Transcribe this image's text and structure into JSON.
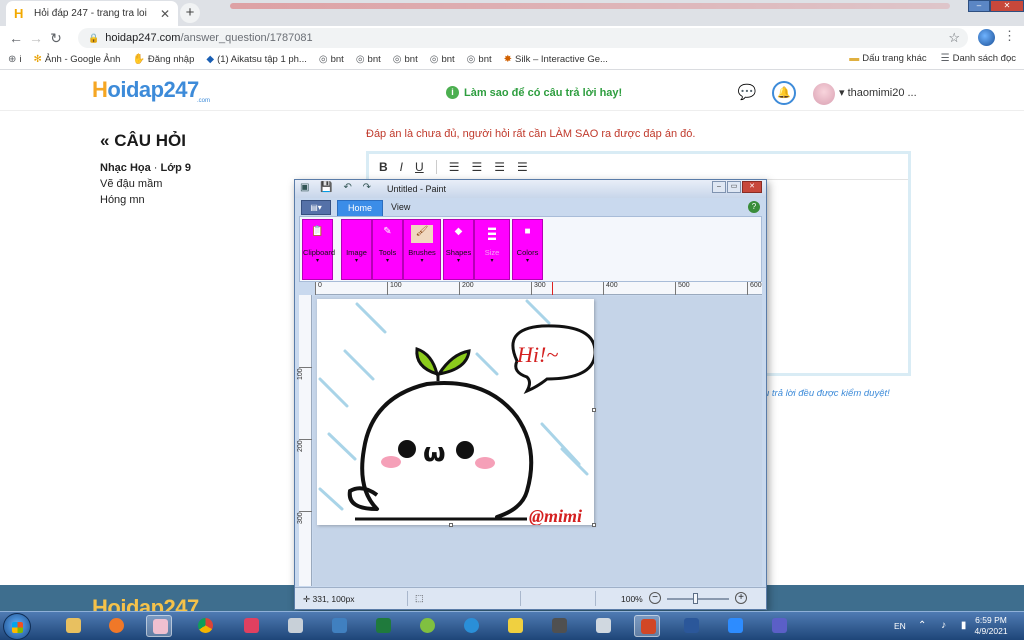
{
  "browser": {
    "tab_title": "Hỏi đáp 247 - trang tra loi",
    "tab_favicon": "H",
    "new_tab": "+",
    "url_host": "hoidap247.com",
    "url_path": "/answer_question/1787081",
    "bookmarks": [
      {
        "icon": "apps-icon",
        "label": "i"
      },
      {
        "icon": "google-photos-icon",
        "label": "Ảnh - Google Ảnh"
      },
      {
        "icon": "hand-icon",
        "label": "Đăng nhập"
      },
      {
        "icon": "azota-icon",
        "label": "(1) Aikatsu tập 1 ph..."
      },
      {
        "icon": "globe-icon",
        "label": "bnt"
      },
      {
        "icon": "globe-icon",
        "label": "bnt"
      },
      {
        "icon": "globe-icon",
        "label": "bnt"
      },
      {
        "icon": "globe-icon",
        "label": "bnt"
      },
      {
        "icon": "globe-icon",
        "label": "bnt"
      },
      {
        "icon": "silk-icon",
        "label": "Silk – Interactive Ge..."
      }
    ],
    "bookmarks_other": "Dấu trang khác",
    "reading_list": "Danh sách đọc"
  },
  "site": {
    "logo_h": "H",
    "logo_rest": "oidap247",
    "logo_sub": ".com",
    "tip": "Làm sao để có câu trả lời hay!",
    "username": "thaomimi20 ...",
    "question_heading": "CÂU HỎI",
    "subject": "Nhạc Họa",
    "grade": "Lớp 9",
    "question_line1": "Vẽ đậu mầm",
    "question_line2": "Hóng mn",
    "warning": "Đáp án là chưa đủ, người hỏi rất cần LÀM SAO ra được đáp án đó.",
    "editor_tools": [
      "B",
      "I",
      "U"
    ],
    "note_suffix": "u trả lời đều được kiểm duyệt!",
    "footer_logo": "Hoidap247"
  },
  "paint": {
    "title": "Untitled - Paint",
    "tabs": [
      "Home",
      "View"
    ],
    "groups": [
      "Clipboard",
      "Image",
      "Tools",
      "Brushes",
      "Shapes",
      "Size",
      "Colors"
    ],
    "ruler_h": [
      "0",
      "100",
      "200",
      "300",
      "400",
      "500",
      "600"
    ],
    "ruler_v": [
      "100",
      "200",
      "300"
    ],
    "canvas_text_hi": "Hi!~",
    "canvas_text_face": "ω",
    "canvas_text_sign": "@mimi",
    "status_pos": "331, 100px",
    "zoom": "100%"
  },
  "taskbar": {
    "lang": "EN",
    "time": "6:59 PM",
    "date": "4/9/2021"
  },
  "colors": {
    "ribbon_group": "#ff00ff",
    "logo_orange": "#f5a623",
    "logo_blue": "#3d8bd9",
    "warning_red": "#c0392b",
    "tip_green": "#2e9e3f"
  }
}
